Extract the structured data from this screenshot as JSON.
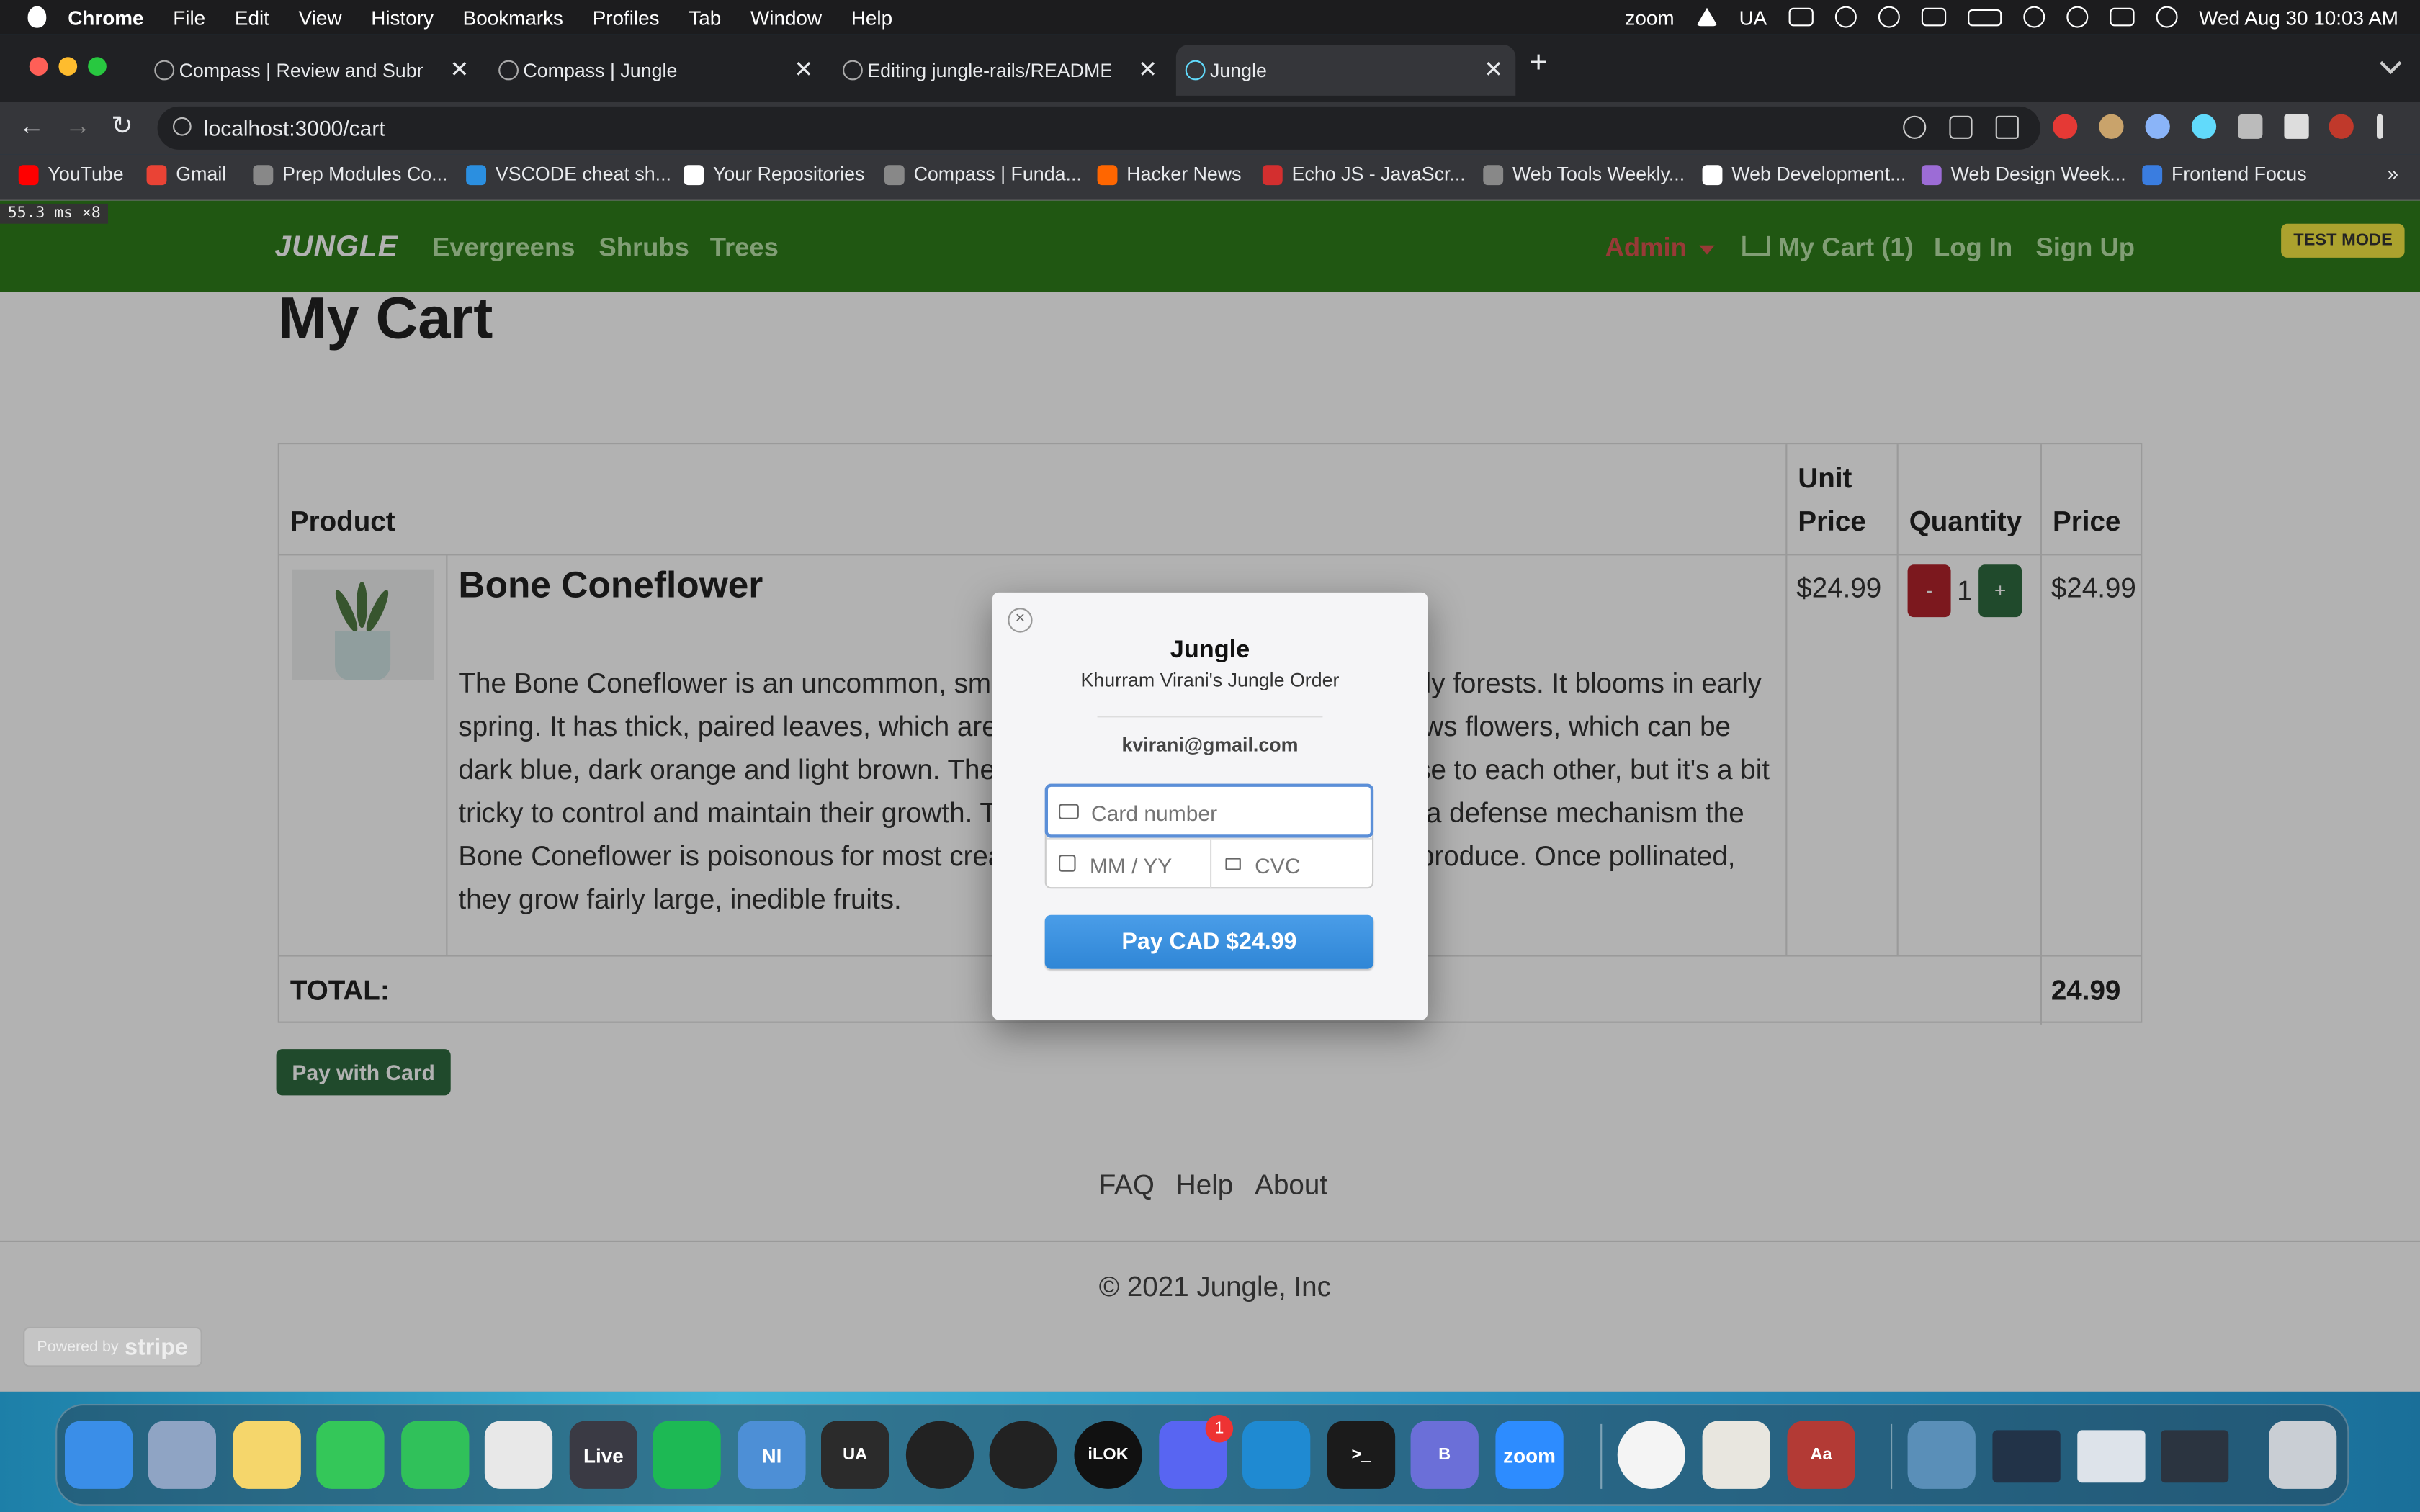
{
  "menubar": {
    "app": "Chrome",
    "items": [
      "File",
      "Edit",
      "View",
      "History",
      "Bookmarks",
      "Profiles",
      "Tab",
      "Window",
      "Help"
    ],
    "zoom": "zoom",
    "ua": "UA",
    "datetime": "Wed Aug 30  10:03 AM"
  },
  "tabs": [
    {
      "label": "Compass | Review and Submit",
      "close": "✕"
    },
    {
      "label": "Compass | Jungle",
      "close": "✕"
    },
    {
      "label": "Editing jungle-rails/README.md",
      "close": "✕"
    },
    {
      "label": "Jungle",
      "close": "✕"
    }
  ],
  "toolbar": {
    "url": "localhost:3000/cart",
    "back": "←",
    "forward": "→",
    "reload": "↻",
    "newtab": "+"
  },
  "bookmarks": [
    {
      "label": "YouTube",
      "color": "#ff0000"
    },
    {
      "label": "Gmail",
      "color": "#ea4335"
    },
    {
      "label": "Prep Modules Co...",
      "color": "#888888"
    },
    {
      "label": "VSCODE cheat sh...",
      "color": "#2b8fe0"
    },
    {
      "label": "Your Repositories",
      "color": "#ffffff"
    },
    {
      "label": "Compass | Funda...",
      "color": "#888888"
    },
    {
      "label": "Hacker News",
      "color": "#ff6600"
    },
    {
      "label": "Echo JS - JavaScr...",
      "color": "#d32f2f"
    },
    {
      "label": "Web Tools Weekly...",
      "color": "#888888"
    },
    {
      "label": "Web Development...",
      "color": "#ffffff"
    },
    {
      "label": "Web Design Week...",
      "color": "#9c6cd6"
    },
    {
      "label": "Frontend Focus",
      "color": "#3a7de0"
    }
  ],
  "bookmarks_more": "»",
  "perf": "55.3 ms ×8",
  "site": {
    "brand": "JUNGLE",
    "nav": [
      "Evergreens",
      "Shrubs",
      "Trees"
    ],
    "admin": "Admin",
    "cart": "My Cart (1)",
    "login": "Log In",
    "signup": "Sign Up",
    "test_mode": "TEST MODE"
  },
  "cart": {
    "title": "My Cart",
    "headers": {
      "product": "Product",
      "unit_price": "Unit Price",
      "quantity": "Quantity",
      "price": "Price"
    },
    "item": {
      "name": "Bone Coneflower",
      "description": "The Bone Coneflower is an uncommon, small plant which can be found in shady forests. It blooms in early spring. It has thick, paired leaves, which are usually green or brown. It also grows flowers, which can be dark blue, dark orange and light brown. These plants grow in large groups, close to each other, but it's a bit tricky to control and maintain their growth. The flowers and leaves are used as a defense mechanism the Bone Coneflower is poisonous for most creatures, and it relies on insects to reproduce. Once pollinated, they grow fairly large, inedible fruits.",
      "unit_price": "$24.99",
      "quantity": "1",
      "minus": "-",
      "plus": "+",
      "price": "$24.99"
    },
    "total_label": "TOTAL:",
    "total_value": "24.99",
    "pay_button": "Pay with Card"
  },
  "footer": {
    "links": [
      "FAQ",
      "Help",
      "About"
    ],
    "copyright": "© 2021 Jungle, Inc"
  },
  "stripe_badge": {
    "prefix": "Powered by",
    "brand": "stripe"
  },
  "checkout": {
    "title": "Jungle",
    "subtitle": "Khurram Virani's Jungle Order",
    "email": "kvirani@gmail.com",
    "card_placeholder": "Card number",
    "expiry_placeholder": "MM / YY",
    "cvc_placeholder": "CVC",
    "pay_label": "Pay CAD $24.99",
    "close": "×"
  },
  "dock": [
    {
      "label": "",
      "color": "#3a8ee8"
    },
    {
      "label": "",
      "color": "#8fa4c4"
    },
    {
      "label": "",
      "color": "#f5d66b"
    },
    {
      "label": "",
      "color": "#34c759"
    },
    {
      "label": "",
      "color": "#30c15a"
    },
    {
      "label": "",
      "color": "#e8e8e8"
    },
    {
      "label": "Live",
      "color": "#3a3a44"
    },
    {
      "label": "",
      "color": "#1db954"
    },
    {
      "label": "NI",
      "color": "#4d8fd6"
    },
    {
      "label": "UA",
      "color": "#2b2b2b"
    },
    {
      "label": "",
      "color": "#222222"
    },
    {
      "label": "",
      "color": "#222222"
    },
    {
      "label": "iLOK",
      "color": "#111111"
    },
    {
      "label": "",
      "color": "#5865f2",
      "badge": "1"
    },
    {
      "label": "",
      "color": "#1f8ad2"
    },
    {
      "label": ">_",
      "color": "#1b1b1b"
    },
    {
      "label": "B",
      "color": "#6b6fd8"
    },
    {
      "label": "zoom",
      "color": "#2d8cff"
    },
    {
      "label": "",
      "color": "#f4f4f4"
    },
    {
      "label": "",
      "color": "#e8e6df"
    },
    {
      "label": "Aa",
      "color": "#b33a35"
    },
    {
      "label": "",
      "color": "#5a8fb8"
    },
    {
      "label": "",
      "color": "#223348"
    },
    {
      "label": "",
      "color": "#dde3ea"
    },
    {
      "label": "",
      "color": "#2b3440"
    },
    {
      "label": "",
      "color": "#c9ced4"
    }
  ]
}
